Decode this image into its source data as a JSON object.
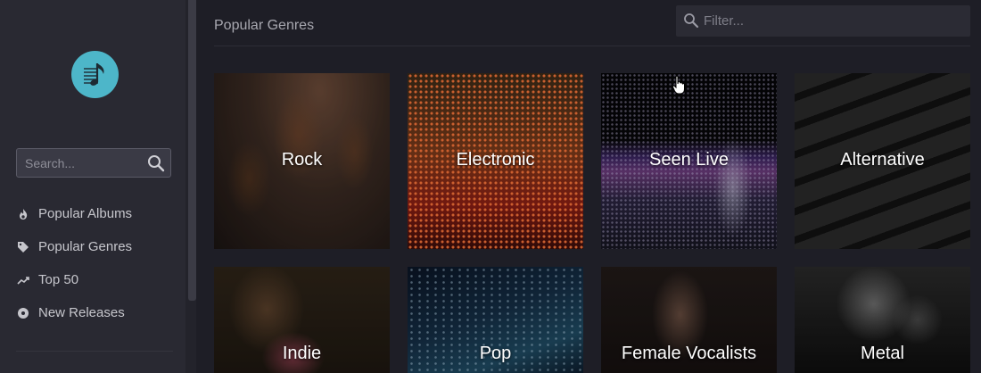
{
  "sidebar": {
    "logo": "music-note-logo",
    "search": {
      "placeholder": "Search...",
      "icon": "search-icon"
    },
    "nav": [
      {
        "label": "Popular Albums",
        "icon": "flame-icon"
      },
      {
        "label": "Popular Genres",
        "icon": "tag-icon"
      },
      {
        "label": "Top 50",
        "icon": "trending-icon"
      },
      {
        "label": "New Releases",
        "icon": "disc-icon"
      }
    ]
  },
  "main": {
    "title": "Popular Genres",
    "filter": {
      "placeholder": "Filter...",
      "icon": "search-icon"
    },
    "genres": [
      {
        "label": "Rock"
      },
      {
        "label": "Electronic"
      },
      {
        "label": "Seen Live"
      },
      {
        "label": "Alternative"
      },
      {
        "label": "Indie"
      },
      {
        "label": "Pop"
      },
      {
        "label": "Female Vocalists"
      },
      {
        "label": "Metal"
      }
    ]
  },
  "colors": {
    "background": "#1e1e26",
    "sidebar": "#292932",
    "accent": "#4db6c9"
  }
}
